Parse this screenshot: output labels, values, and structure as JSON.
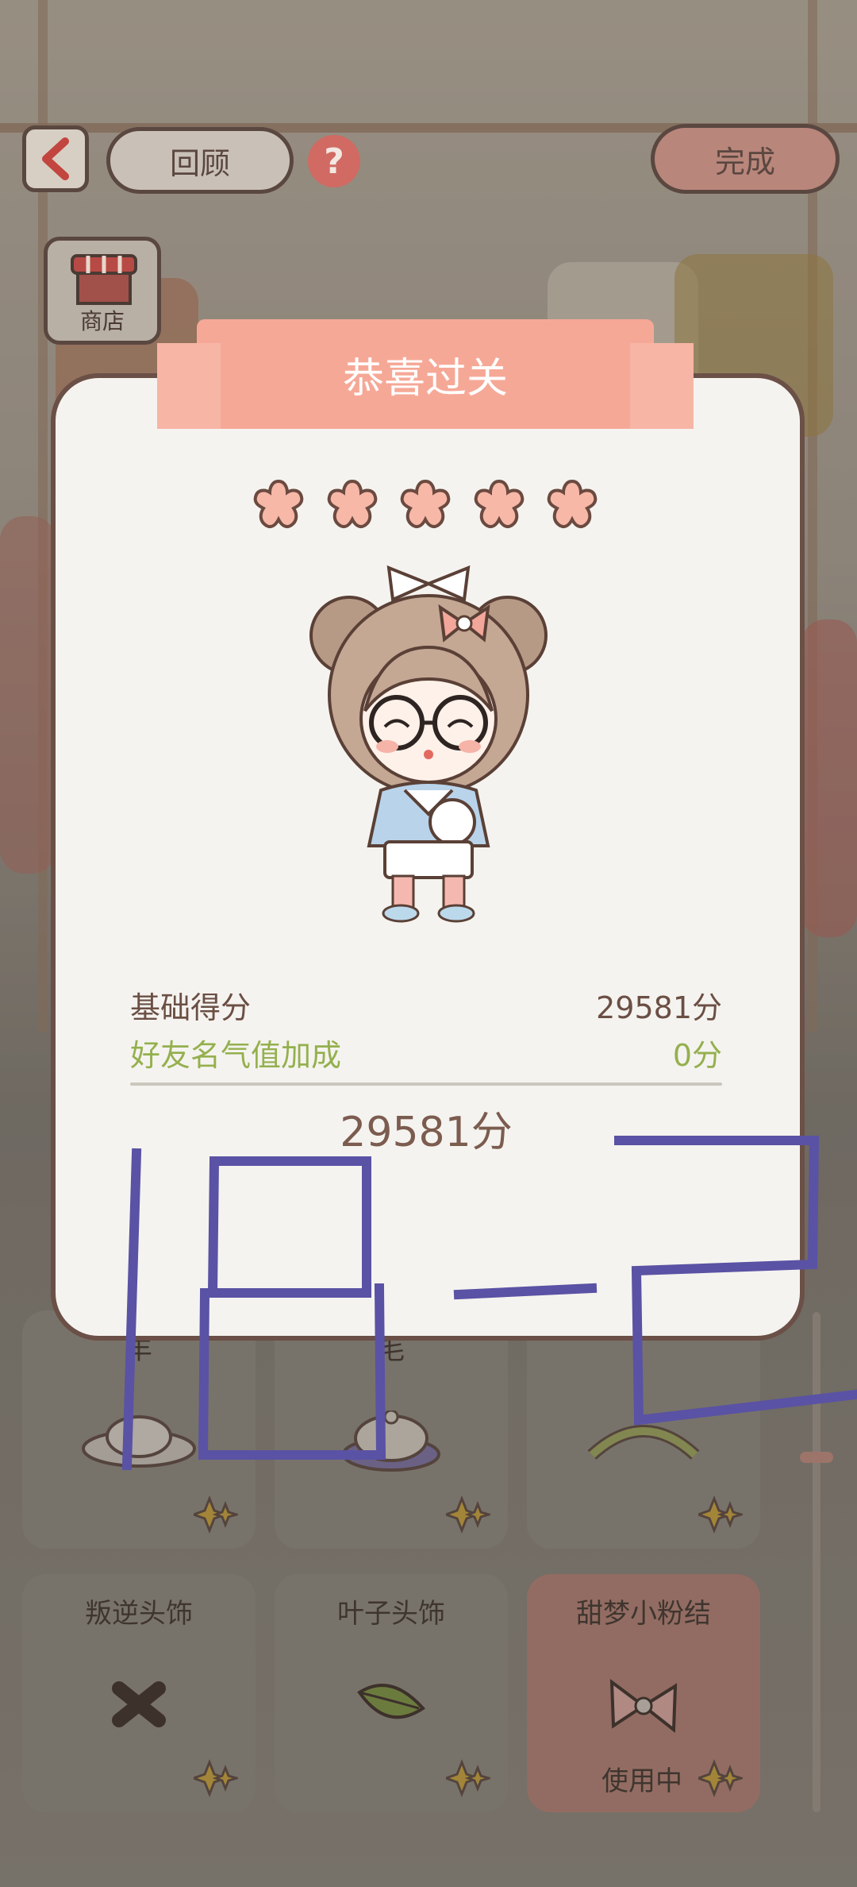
{
  "header": {
    "review_label": "回顾",
    "done_label": "完成",
    "shop_label": "商店"
  },
  "modal": {
    "title": "恭喜过关",
    "stars_count": 5,
    "base_score_label": "基础得分",
    "base_score_value": "29581分",
    "bonus_label": "好友名气值加成",
    "bonus_value": "0分",
    "total_value": "29581分"
  },
  "items": [
    {
      "name": "丰",
      "status": ""
    },
    {
      "name": "毛",
      "status": ""
    },
    {
      "name": "",
      "status": ""
    },
    {
      "name": "叛逆头饰",
      "status": ""
    },
    {
      "name": "叶子头饰",
      "status": ""
    },
    {
      "name": "甜梦小粉结",
      "status": "使用中"
    }
  ],
  "colors": {
    "accent": "#f6a897",
    "bonus_green": "#94b04e",
    "text_brown": "#7b5c4f",
    "scribble": "#5a52a4"
  }
}
